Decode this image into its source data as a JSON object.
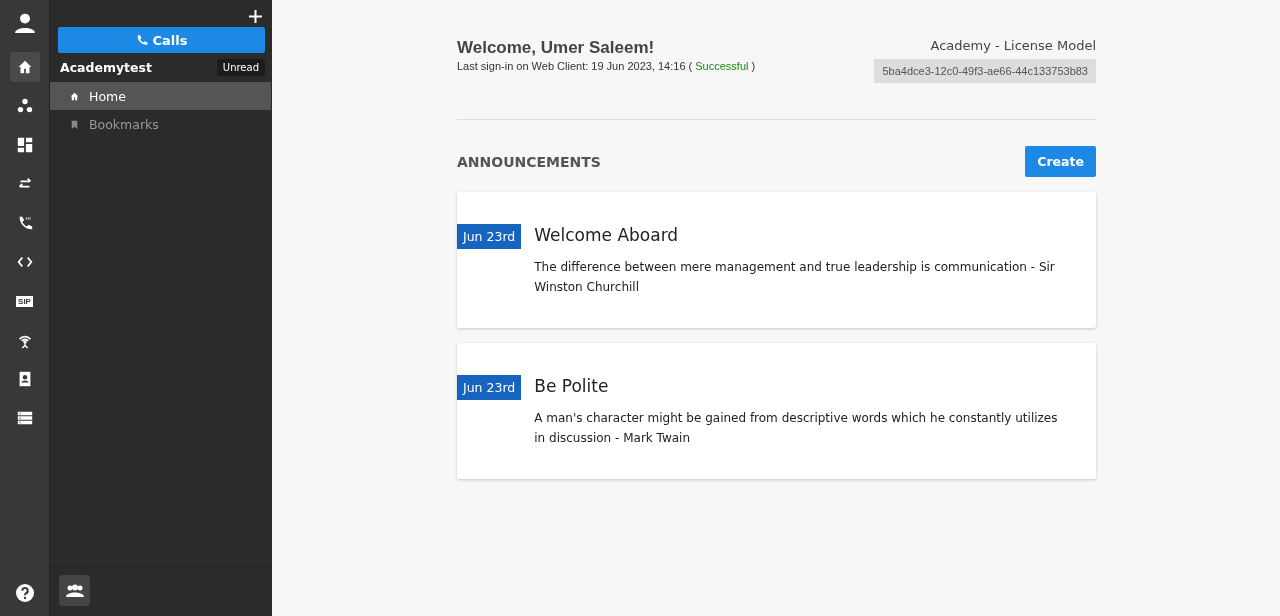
{
  "rail": {
    "items": [
      {
        "kind": "home",
        "selected": true
      },
      {
        "kind": "cluster",
        "selected": false
      },
      {
        "kind": "dashboard",
        "selected": false
      },
      {
        "kind": "swap",
        "selected": false
      },
      {
        "kind": "phone",
        "selected": false
      },
      {
        "kind": "code",
        "selected": false
      },
      {
        "kind": "sip",
        "label": "SIP",
        "selected": false
      },
      {
        "kind": "antenna",
        "selected": false
      },
      {
        "kind": "contact",
        "selected": false
      },
      {
        "kind": "list",
        "selected": false
      }
    ]
  },
  "sidebar": {
    "calls_button": "Calls",
    "account": "Academytest",
    "badge": "Unread",
    "items": [
      {
        "label": "Home",
        "kind": "home",
        "selected": true
      },
      {
        "label": "Bookmarks",
        "kind": "bookmark",
        "selected": false
      }
    ]
  },
  "header": {
    "greeting": "Welcome, Umer Saleem!",
    "signin_prefix": "Last sign-in on Web Client: 19 Jun 2023, 14:16 (",
    "signin_status": "Successful",
    "signin_suffix": ")",
    "license": "Academy - License Model",
    "license_key": "5ba4dce3-12c0-49f3-ae66-44c133753b83"
  },
  "announcements": {
    "title": "ANNOUNCEMENTS",
    "create_button": "Create",
    "items": [
      {
        "date": "Jun 23rd",
        "title": "Welcome Aboard",
        "body": "The difference between mere management and true leadership is communication - Sir Winston Churchill"
      },
      {
        "date": "Jun 23rd",
        "title": "Be Polite",
        "body": "A man's character might be gained from descriptive words which he constantly utilizes in discussion - Mark Twain"
      }
    ]
  }
}
